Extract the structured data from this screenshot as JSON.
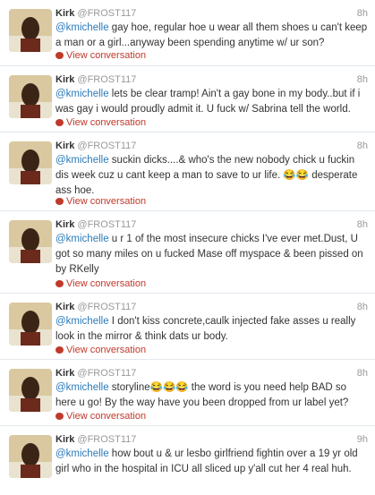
{
  "tweets": [
    {
      "name": "Kirk",
      "handle": "@FROST117",
      "time": "8h",
      "mention": "@kmichelle",
      "text": " gay hoe, regular hoe u wear all them shoes u can't keep a man or a girl...anyway been spending anytime w/ ur son?",
      "convo": "View conversation"
    },
    {
      "name": "Kirk",
      "handle": "@FROST117",
      "time": "8h",
      "mention": "@kmichelle",
      "text": " lets be clear tramp! Ain't a gay bone in my body..but if i was gay i would proudly admit it. U fuck w/ Sabrina tell the world.",
      "convo": "View conversation"
    },
    {
      "name": "Kirk",
      "handle": "@FROST117",
      "time": "8h",
      "mention": "@kmichelle",
      "text": " suckin dicks....& who's the new nobody chick u fuckin dis week cuz u cant keep a man to save to ur life. 😂😂 desperate ass hoe.",
      "convo": "View conversation"
    },
    {
      "name": "Kirk",
      "handle": "@FROST117",
      "time": "8h",
      "mention": "@kmichelle",
      "text": " u r 1 of the most insecure chicks I've ever met.Dust, U got so many miles on u fucked Mase off myspace & been pissed on by RKelly",
      "convo": "View conversation"
    },
    {
      "name": "Kirk",
      "handle": "@FROST117",
      "time": "8h",
      "mention": "@kmichelle",
      "text": " I don't kiss concrete,caulk injected fake asses u really look in the mirror & think dats ur body.",
      "convo": "View conversation"
    },
    {
      "name": "Kirk",
      "handle": "@FROST117",
      "time": "8h",
      "mention": "@kmichelle",
      "text": " storyline😂😂😂 the word is you need help BAD so here u go! By the way have you been dropped from ur label yet?",
      "convo": "View conversation"
    },
    {
      "name": "Kirk",
      "handle": "@FROST117",
      "time": "9h",
      "mention": "@kmichelle",
      "text": " how bout u & ur lesbo girlfriend fightin over a 19 yr old girl who in the hospital in ICU all sliced up y'all cut her 4 real huh.",
      "convo": "View conversation"
    }
  ]
}
